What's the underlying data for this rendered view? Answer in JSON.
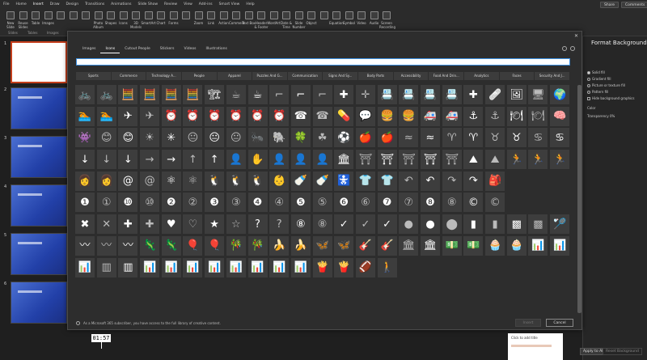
{
  "menubar": {
    "tabs": [
      "File",
      "Home",
      "Insert",
      "Draw",
      "Design",
      "Transitions",
      "Animations",
      "Slide Show",
      "Review",
      "View",
      "Add-ins",
      "Smart View",
      "Help"
    ],
    "active": "Insert",
    "share_label": "Share",
    "comments_label": "Comments"
  },
  "ribbon": {
    "buttons": [
      "New Slide",
      "Reuse Slides",
      "Table",
      "Images",
      "",
      "",
      "",
      "Photo Album",
      "Shapes",
      "Icons",
      "3D Models",
      "SmartArt",
      "Chart",
      "Forms",
      "",
      "Zoom",
      "Link",
      "Action",
      "Comment",
      "Text Box",
      "Header & Footer",
      "WordArt",
      "Date & Time",
      "Slide Number",
      "Object",
      "",
      "Equation",
      "Symbol",
      "Video",
      "Audio",
      "Screen Recording"
    ],
    "groups": [
      "Slides",
      "Tables",
      "Images"
    ]
  },
  "thumbnails": {
    "numbers": [
      "1",
      "2",
      "3",
      "4",
      "5",
      "6"
    ]
  },
  "right_pane": {
    "title": "Format Background",
    "options": [
      "Solid fill",
      "Gradient fill",
      "Picture or texture fill",
      "Pattern fill",
      "Hide background graphics"
    ],
    "color_label": "Color",
    "transparency_label": "Transparency",
    "transparency_value": "0%",
    "apply_all_label": "Apply to All",
    "reset_label": "Reset Background"
  },
  "dialog": {
    "tabs": [
      "Images",
      "Icons",
      "Cutout People",
      "Stickers",
      "Videos",
      "Illustrations"
    ],
    "active_tab": "Icons",
    "search_placeholder": "",
    "categories": [
      "Sports",
      "Commerce",
      "Technology A...",
      "People",
      "Apparel",
      "Puzzles And G...",
      "Communication",
      "Signs And Sy...",
      "Body Parts",
      "Accessibility",
      "Food And Drin...",
      "Analytics",
      "Faces",
      "Security And J..."
    ],
    "footer_text": "As a Microsoft 365 subscriber, you have access to the full library of creative content.",
    "insert_label": "Insert",
    "cancel_label": "Cancel"
  },
  "icon_rows": [
    [
      "🚲",
      "🚲",
      "🧮",
      "🧮",
      "🧮",
      "🧮",
      "🏗",
      "☕",
      "☕",
      "⌐",
      "⌐",
      "⌐",
      "✚",
      "✛",
      "📇",
      "📇",
      "📇",
      "📇",
      "✚",
      "🩹",
      "🖼",
      "🖥",
      "🌍"
    ],
    [
      "🏊",
      "🏊",
      "✈",
      "✈",
      "⏰",
      "⏰",
      "⏰",
      "⏰",
      "⏰",
      "⏰",
      "☎",
      "☎",
      "💊",
      "💬",
      "🍔",
      "🍔",
      "🚑",
      "🚑",
      "⚓",
      "⚓",
      "🍽",
      "🍽",
      "🧠"
    ],
    [
      "👾",
      "😊",
      "😊",
      "☀",
      "✳",
      "😐",
      "😐",
      "😐",
      "🐜",
      "🐘",
      "🍀",
      "☘",
      "⚽",
      "🍎",
      "🍎",
      "≈",
      "≈",
      "♈",
      "♈",
      "♉",
      "♉",
      "♋",
      "♋"
    ],
    [
      "↓",
      "↓",
      "↓",
      "→",
      "→",
      "↑",
      "↑",
      "👤",
      "✋",
      "👤",
      "👤",
      "👤",
      "🏛",
      "⛩",
      "⛩",
      "⛩",
      "⛩",
      "⛩",
      "⛰",
      "⛰",
      "🏃",
      "🏃",
      "🏃"
    ],
    [
      "👩",
      "👩",
      "@",
      "@",
      "⚛",
      "⚛",
      "🐧",
      "🐧",
      "🐧",
      "👶",
      "🍼",
      "🍼",
      "🚼",
      "👕",
      "👕",
      "↶",
      "↶",
      "↷",
      "↷",
      "🎒",
      "",
      "",
      ""
    ],
    [
      "❶",
      "①",
      "❿",
      "⑩",
      "❷",
      "②",
      "❸",
      "③",
      "❹",
      "④",
      "❺",
      "⑤",
      "❻",
      "⑥",
      "❼",
      "⑦",
      "❽",
      "⑧",
      "©",
      "©",
      "",
      "",
      ""
    ],
    [
      "✖",
      "✕",
      "✚",
      "✚",
      "♥",
      "♡",
      "★",
      "☆",
      "?",
      "?",
      "⑧",
      "⑧",
      "✓",
      "✓",
      "✓",
      "●",
      "●",
      "⬤",
      "▮",
      "▮",
      "▩",
      "▩",
      "🏸"
    ],
    [
      "〰",
      "〰",
      "〰",
      "🦎",
      "🦎",
      "🎈",
      "🎈",
      "🎋",
      "🎋",
      "🍌",
      "🍌",
      "🦋",
      "🦋",
      "🎸",
      "🎸",
      "🏛",
      "🏛",
      "💵",
      "💵",
      "🧁",
      "🧁",
      "📊",
      "📊"
    ],
    [
      "📊",
      "▥",
      "▥",
      "📊",
      "📊",
      "📊",
      "📊",
      "📊",
      "📊",
      "📊",
      "📊",
      "🍟",
      "🍟",
      "🏈",
      "🚶",
      "",
      "",
      "",
      "",
      "",
      "",
      "",
      ""
    ]
  ],
  "timer": "01:57",
  "notes_text": "Click to add title"
}
